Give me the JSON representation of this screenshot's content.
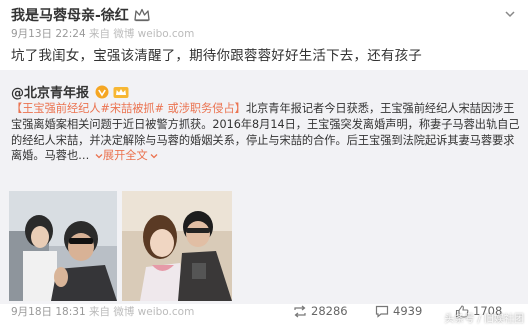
{
  "post": {
    "author": "我是马蓉母亲-徐红",
    "crown_icon": "crown-icon",
    "timestamp": "9月13日 22:24",
    "source": "来自 微博 weibo.com",
    "text": "坑了我闺女，宝强该清醒了，期待你跟蓉蓉好好生活下去，还有孩子"
  },
  "repost": {
    "author": "@北京青年报",
    "verified_icon": "verified-v-icon",
    "member_icon": "gold-crown-icon",
    "tag_open": "【王宝强前经纪人#宋喆被抓# 或涉职务侵占】",
    "body": "北京青年报记者今日获悉，王宝强前经纪人宋喆因涉王宝强离婚案相关问题于近日被警方抓获。2016年8月14日，王宝强突发离婚声明，称妻子马蓉出轨自己的经纪人宋喆，并决定解除与马蓉的婚姻关系，停止与宋喆的合作。后王宝强到法院起诉其妻马蓉要求离婚。马蓉也",
    "more_label": "展开全文",
    "timestamp": "9月18日 18:31",
    "source": "来自 微博 weibo.com",
    "stats": {
      "reposts": "28286",
      "comments": "4939",
      "likes": "1708"
    }
  },
  "watermark": "头条号 / 旧娱社团",
  "colors": {
    "link": "#eb7350",
    "repost_bg": "#f2f2f5",
    "verified": "#f5a623"
  }
}
